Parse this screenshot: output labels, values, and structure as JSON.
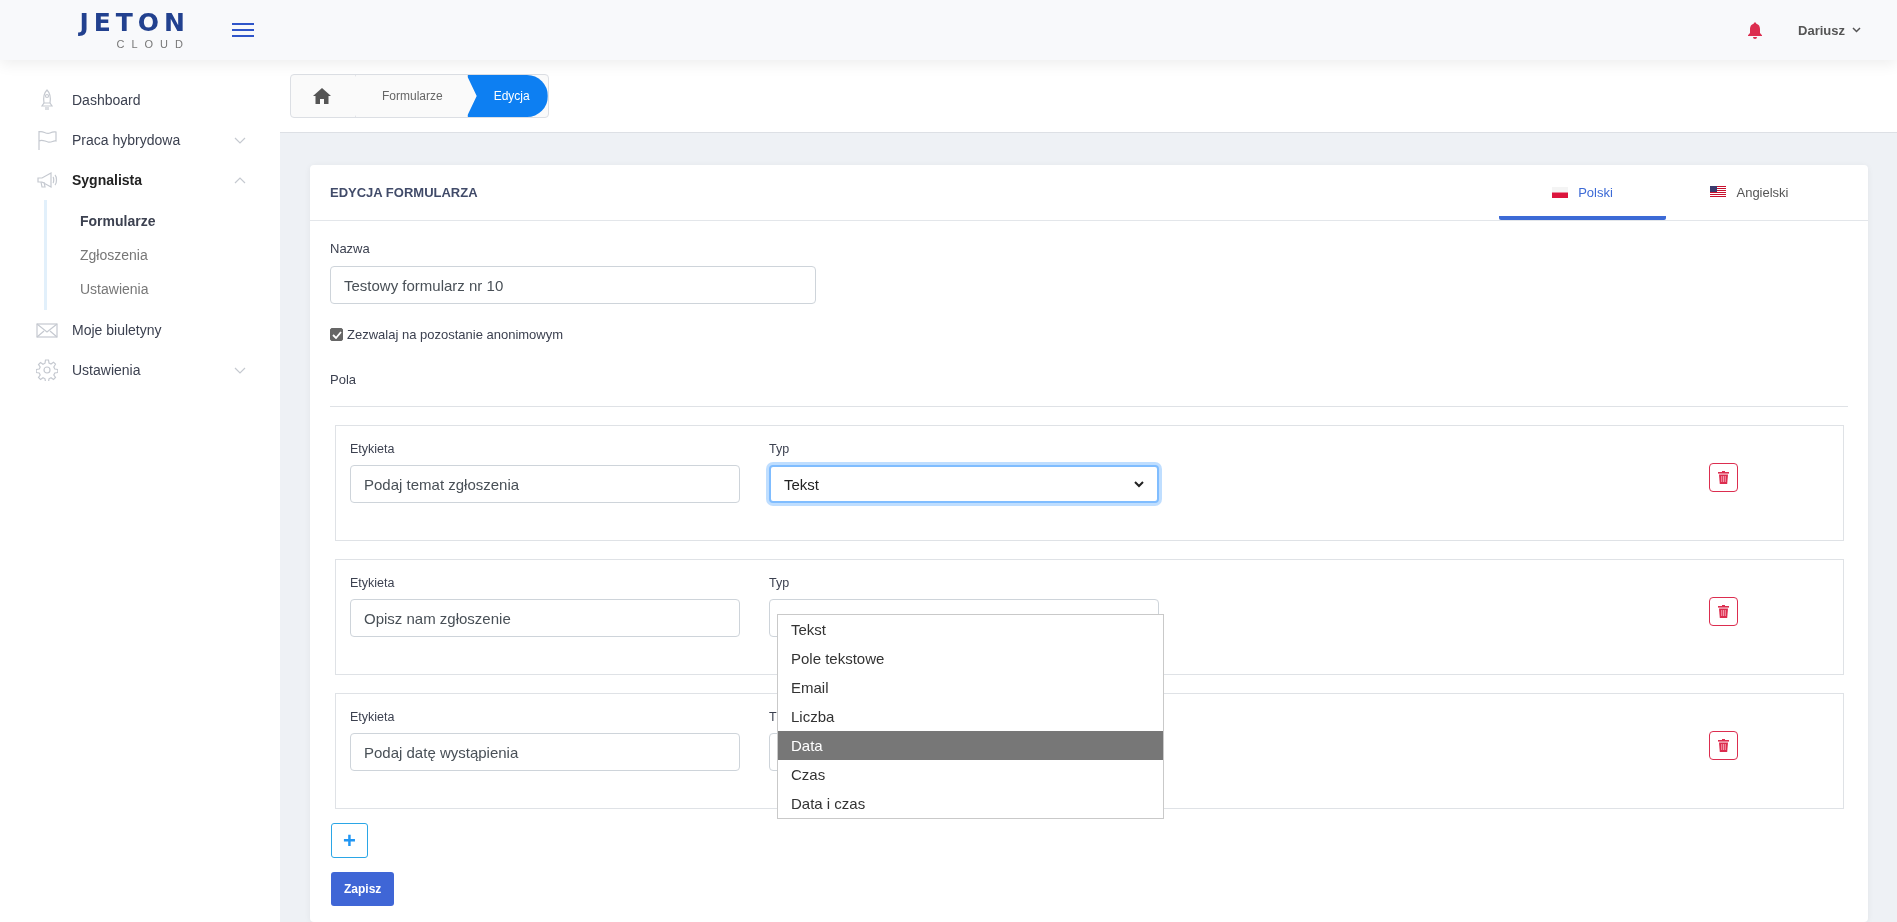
{
  "header": {
    "logo_main": "JETON",
    "logo_sub": "CLOUD",
    "user": "Dariusz"
  },
  "sidebar": {
    "items": [
      {
        "label": "Dashboard",
        "kind": "rocket",
        "expanded": false,
        "has_chevron": false
      },
      {
        "label": "Praca hybrydowa",
        "kind": "flag",
        "expanded": false,
        "has_chevron": true
      },
      {
        "label": "Sygnalista",
        "kind": "megaphone",
        "expanded": true,
        "has_chevron": true,
        "children": [
          {
            "label": "Formularze",
            "selected": true
          },
          {
            "label": "Zgłoszenia",
            "selected": false
          },
          {
            "label": "Ustawienia",
            "selected": false
          }
        ]
      },
      {
        "label": "Moje biuletyny",
        "kind": "mail",
        "expanded": false,
        "has_chevron": false
      },
      {
        "label": "Ustawienia",
        "kind": "gear",
        "expanded": false,
        "has_chevron": true
      }
    ]
  },
  "breadcrumb": [
    {
      "label": "Formularze",
      "selected": false
    },
    {
      "label": "Edycja",
      "selected": true
    }
  ],
  "card": {
    "title": "EDYCJA FORMULARZA",
    "tabs": [
      {
        "label": "Polski",
        "kind": "pl",
        "selected": true
      },
      {
        "label": "Angielski",
        "kind": "us",
        "selected": false
      }
    ],
    "name_label": "Nazwa",
    "name_value": "Testowy formularz nr 10",
    "anonymous": {
      "label": "Zezwalaj na pozostanie anonimowym",
      "checked": true
    },
    "fields_heading": "Pola",
    "fields": [
      {
        "label_caption": "Etykieta",
        "label_value": "Podaj temat zgłoszenia",
        "type_caption": "Typ",
        "type_value": "Tekst",
        "focused": true
      },
      {
        "label_caption": "Etykieta",
        "label_value": "Opisz nam zgłoszenie",
        "type_caption": "Typ",
        "focused": false,
        "dropdown_open": true
      },
      {
        "label_caption": "Etykieta",
        "label_value": "Podaj datę wystąpienia",
        "type_caption": "T",
        "focused": false
      }
    ],
    "dropdown_options": [
      {
        "label": "Tekst",
        "selected": false
      },
      {
        "label": "Pole tekstowe",
        "selected": false
      },
      {
        "label": "Email",
        "selected": false
      },
      {
        "label": "Liczba",
        "selected": false
      },
      {
        "label": "Data",
        "selected": true
      },
      {
        "label": "Czas",
        "selected": false
      },
      {
        "label": "Data i czas",
        "selected": false
      }
    ],
    "add_button": "+",
    "save_button": "Zapisz"
  }
}
